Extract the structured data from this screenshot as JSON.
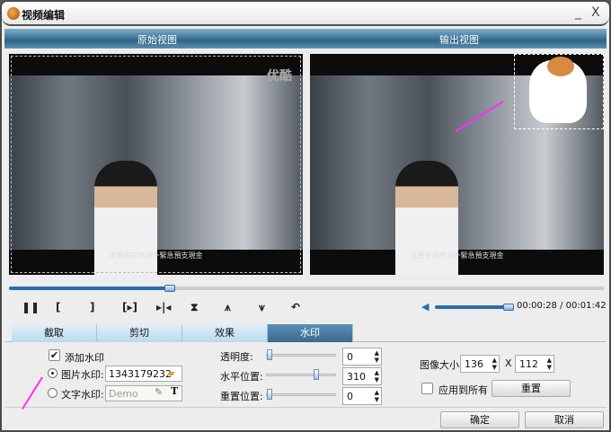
{
  "window": {
    "title": "视频编辑",
    "minimize": "_",
    "close": "X"
  },
  "views": {
    "original": "原始视图",
    "output": "输出视图"
  },
  "video": {
    "subtitle": "滙豐有提供海外緊急預支現金",
    "logo": "优酷"
  },
  "playback": {
    "progress_percent": 27,
    "volume_percent": 100,
    "time": "00:00:28 / 00:01:42",
    "buttons": [
      "❚❚",
      "[",
      "]",
      "[▸]",
      "▸|◂",
      "⧗",
      "⩚",
      "⩛",
      "↶"
    ]
  },
  "tabs": [
    {
      "label": "截取"
    },
    {
      "label": "剪切"
    },
    {
      "label": "效果"
    },
    {
      "label": "水印",
      "active": true
    }
  ],
  "watermark": {
    "add_label": "添加水印",
    "add_checked": true,
    "image_label": "图片水印:",
    "image_value": "1343179232",
    "text_label": "文字水印:",
    "text_placeholder": "Demo",
    "opacity_label": "透明度:",
    "opacity_value": "0",
    "hpos_label": "水平位置:",
    "hpos_value": "310",
    "vpos_label": "重置位置:",
    "vpos_value": "0",
    "size_label": "图像大小:",
    "width": "136",
    "x": "X",
    "height": "112",
    "apply_all_label": "应用到所有",
    "reset_label": "重置"
  },
  "footer": {
    "ok": "确定",
    "cancel": "取消"
  }
}
